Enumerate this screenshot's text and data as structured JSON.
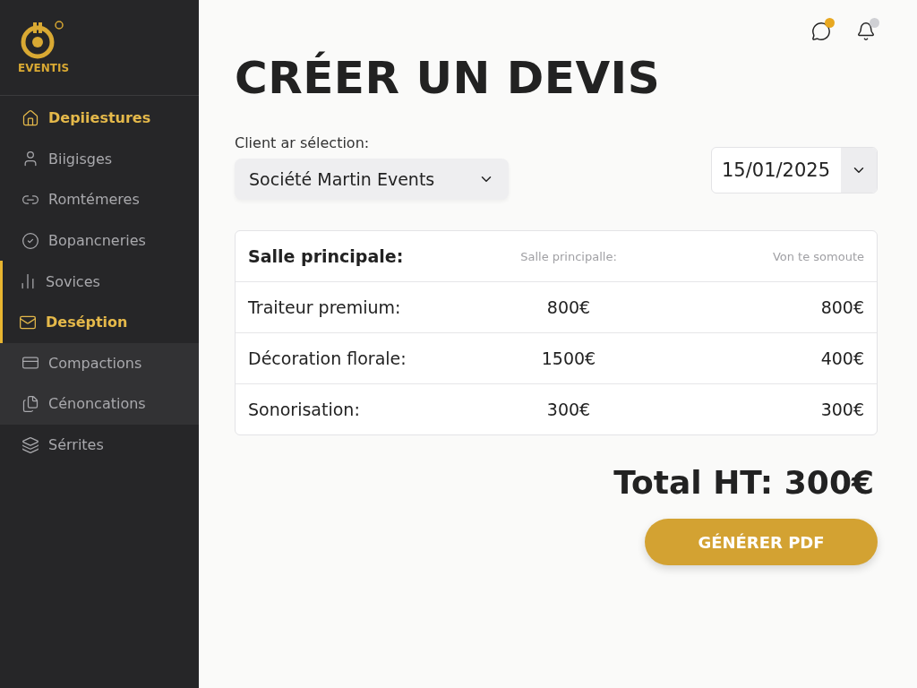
{
  "brand": {
    "name": "EVENTIS"
  },
  "sidebar": {
    "items": [
      {
        "label": "Depiiestures",
        "selected": true,
        "accent_bar": false,
        "highlighted": false
      },
      {
        "label": "Biigisges",
        "selected": false,
        "accent_bar": false,
        "highlighted": false
      },
      {
        "label": "Romtémeres",
        "selected": false,
        "accent_bar": false,
        "highlighted": false
      },
      {
        "label": "Bopancneries",
        "selected": false,
        "accent_bar": false,
        "highlighted": false
      },
      {
        "label": "Sovices",
        "selected": false,
        "accent_bar": true,
        "highlighted": false
      },
      {
        "label": "Deséption",
        "selected": true,
        "accent_bar": true,
        "highlighted": false
      },
      {
        "label": "Compactions",
        "selected": false,
        "accent_bar": false,
        "highlighted": true
      },
      {
        "label": "Cénoncations",
        "selected": false,
        "accent_bar": false,
        "highlighted": true
      },
      {
        "label": "Sérrites",
        "selected": false,
        "accent_bar": false,
        "highlighted": false
      }
    ]
  },
  "header": {
    "notifications": [
      {
        "color": "#e8a820"
      },
      {
        "color": "#cfd0d4"
      }
    ]
  },
  "title": "CRÉER UN DEVIS",
  "client": {
    "label": "Client ar sélection:",
    "value": "Société Martin Events"
  },
  "date": {
    "value": "15/01/2025"
  },
  "table": {
    "columns": [
      "Salle principale:",
      "Salle principalle:",
      "Von te somoute"
    ],
    "rows": [
      [
        "Traiteur premium:",
        "800€",
        "800€"
      ],
      [
        "Décoration florale:",
        "1500€",
        "400€"
      ],
      [
        "Sonorisation:",
        "300€",
        "300€"
      ]
    ]
  },
  "total": "Total HT: 300€",
  "action": "GÉNÉRER PDF"
}
